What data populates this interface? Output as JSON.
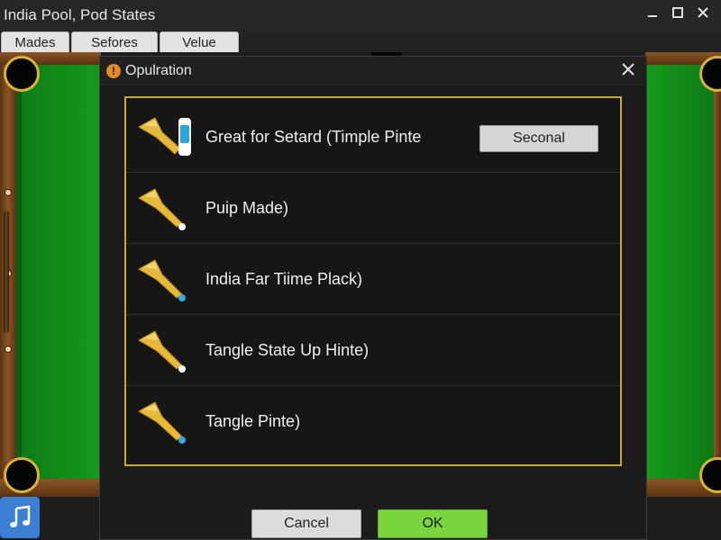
{
  "window": {
    "title": "India Pool, Pod States",
    "minimize_icon": "minimize-icon",
    "maximize_icon": "maximize-icon",
    "close_icon": "close-icon"
  },
  "tabs": [
    {
      "label": "Mades"
    },
    {
      "label": "Sefores"
    },
    {
      "label": "Velue"
    }
  ],
  "dialog": {
    "title": "Opulration",
    "title_icon": "warning-icon",
    "options": [
      {
        "label": "Great for Setard (Timple Pinte",
        "icon": "cue-tip-icon",
        "button_label": "Seconal"
      },
      {
        "label": "Puip Made)",
        "icon": "cue-tip-icon",
        "tip_color": "#ffffff"
      },
      {
        "label": "India Far Tiime Plack)",
        "icon": "cue-tip-icon",
        "tip_color": "#3aa7e0"
      },
      {
        "label": "Tangle State Up Hinte)",
        "icon": "cue-tip-icon",
        "tip_color": "#ffffff"
      },
      {
        "label": "Tangle Pinte)",
        "icon": "cue-tip-icon",
        "tip_color": "#3aa7e0"
      }
    ],
    "cancel_label": "Cancel",
    "ok_label": "OK"
  },
  "bottom_bar": {
    "music_icon": "music-note-icon"
  },
  "colors": {
    "felt": "#159a1c",
    "rail": "#8a5526",
    "panel_border": "#c9a93a",
    "ok_button": "#79d53d",
    "music_button": "#3a7fd4"
  }
}
